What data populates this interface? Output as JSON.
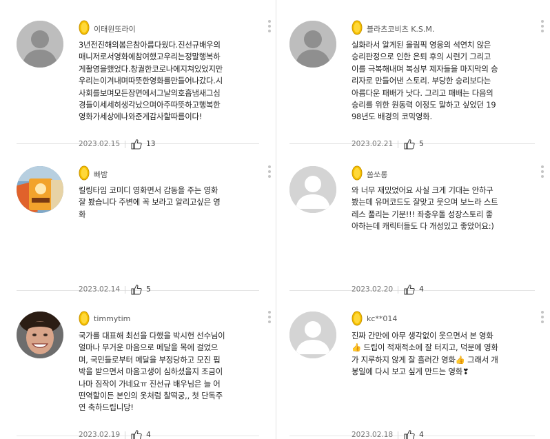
{
  "colors": {
    "badge_gold": "#f0b400",
    "divider": "#e4e4e4",
    "text": "#222222",
    "meta": "#777777"
  },
  "reviews": [
    {
      "nickname": "이태원또라이",
      "avatar": "default-silhouette",
      "text": "3년전진해의봄은참아름다웠다.진선규배우의\n매니저로서영화에참여했고우리는정말행복하\n게촬영을했었다.창궐한코로나에지쳐있었지만\n우리는이겨내며따뜻한영화를만들어나갔다.시\n사회를보며모든장면에서그날의호흡냄새그심\n경들이세세히생각났으며아주따뜻하고행복한\n영화가세상에나와준게감사할따름이다!",
      "date": "2023.02.15",
      "likes": "13"
    },
    {
      "nickname": "블라츠코비츠 K.S.M.",
      "avatar": "default-silhouette",
      "text": "실화라서 알게된 올림픽 영웅의 석연치 않은\n승리판정으로 인한 은퇴 후의 시련기 그리고\n이를 극복해내며 복싱부 제자들을 마지막의 승\n리자로 만들어낸 스토리. 부당한 승리보다는\n아름다운 패배가 낫다. 그리고 패배는 다음의\n승리를 위한 원동력 이정도 말하고 싶었던 19\n98년도 배경의 코믹영화.",
      "date": "2023.02.21",
      "likes": "5"
    },
    {
      "nickname": "빠밤",
      "avatar": "photo-snack",
      "text": "킬링타임 코미디 영화면서 감동을 주는 영화\n잘 봤습니다 주변에 꼭 보라고 알리고싶은 영\n화",
      "date": "2023.02.14",
      "likes": "5"
    },
    {
      "nickname": "쏨쏘롱",
      "avatar": "default-gray",
      "text": "와 너무 재밌었어요 사실 크게 기대는 안하구\n봤는데 유머코드도 잘맞고 웃으며 보느라 스트\n레스 풀리는 기분!!! 좌충우돌 성장스토리 좋\n아하는데 캐릭터들도 다 개성있고 좋았어요:)",
      "date": "2023.02.20",
      "likes": "4"
    },
    {
      "nickname": "timmytim",
      "avatar": "photo-face",
      "text": "국가를 대표해 최선을 다했을 박시헌 선수님이\n얼마나 무거운 마음으로 메달을 목에 걸었으\n며, 국민들로부터 메달을 부정당하고 모진 핍\n박을 받으면서 마음고생이 심하셨을지 조금이\n나마 짐작이 가네요ㅠ 진선규 배우님은 늘 어\n떤역할이든 본인의 옷처럼 찰떡궁,, 첫 단독주\n연 축하드립니당!",
      "date": "2023.02.19",
      "likes": "4"
    },
    {
      "nickname": "kc**014",
      "avatar": "default-gray",
      "text": "진짜 간만에 아무 생각없이 웃으면서 본 영화\n👍 드립이 적재적소에 잘 터지고, 덕분에 영화\n가 지루하지 않게 잘 흘러간 영화👍 그래서 개\n봉일에 다시 보고 싶게 만드는 영화❣",
      "date": "2023.02.18",
      "likes": "4"
    }
  ]
}
